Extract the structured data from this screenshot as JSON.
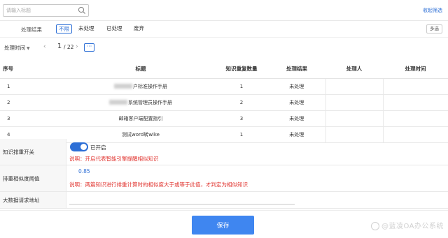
{
  "search": {
    "placeholder": "请输入标题",
    "value": ""
  },
  "topbar": {
    "collapse_label": "收起筛选"
  },
  "filter": {
    "label": "处理结果",
    "options": [
      "不限",
      "未处理",
      "已处理",
      "废弃"
    ],
    "selected": "不限",
    "multi_label": "多选"
  },
  "pager": {
    "sort_label": "处理时间",
    "current_page": "1",
    "total": "/ 22",
    "more": "···"
  },
  "table": {
    "headers": [
      "序号",
      "标题",
      "知识重复数量",
      "处理结果",
      "处理人",
      "处理时间"
    ],
    "rows": [
      [
        "1",
        "户标准操作手册",
        "1",
        "未处理",
        "",
        ""
      ],
      [
        "2",
        "系统管理员操作手册",
        "2",
        "未处理",
        "",
        ""
      ],
      [
        "3",
        "邮箱客户端配置指引",
        "3",
        "未处理",
        "",
        ""
      ],
      [
        "4",
        "测试word转wike",
        "1",
        "未处理",
        "",
        ""
      ]
    ]
  },
  "form": {
    "dedupe": {
      "label": "知识排重开关",
      "state": "已开启",
      "note": "说明：开启代表智能引擎提醒相似知识",
      "enabled": true
    },
    "threshold": {
      "label": "排重相似度阈值",
      "value": "0.85",
      "note": "说明：两篇知识进行排重计算时的相似度大于或等于此值，才判定为相似知识"
    },
    "bigdata": {
      "label": "大数据请求地址",
      "value": ""
    }
  },
  "footer": {
    "save_label": "保存",
    "watermark": "@蓝凌OA办公系统"
  },
  "colors": {
    "accent": "#2d6fd6",
    "button": "#3f86f0",
    "warning": "#e0322d"
  }
}
